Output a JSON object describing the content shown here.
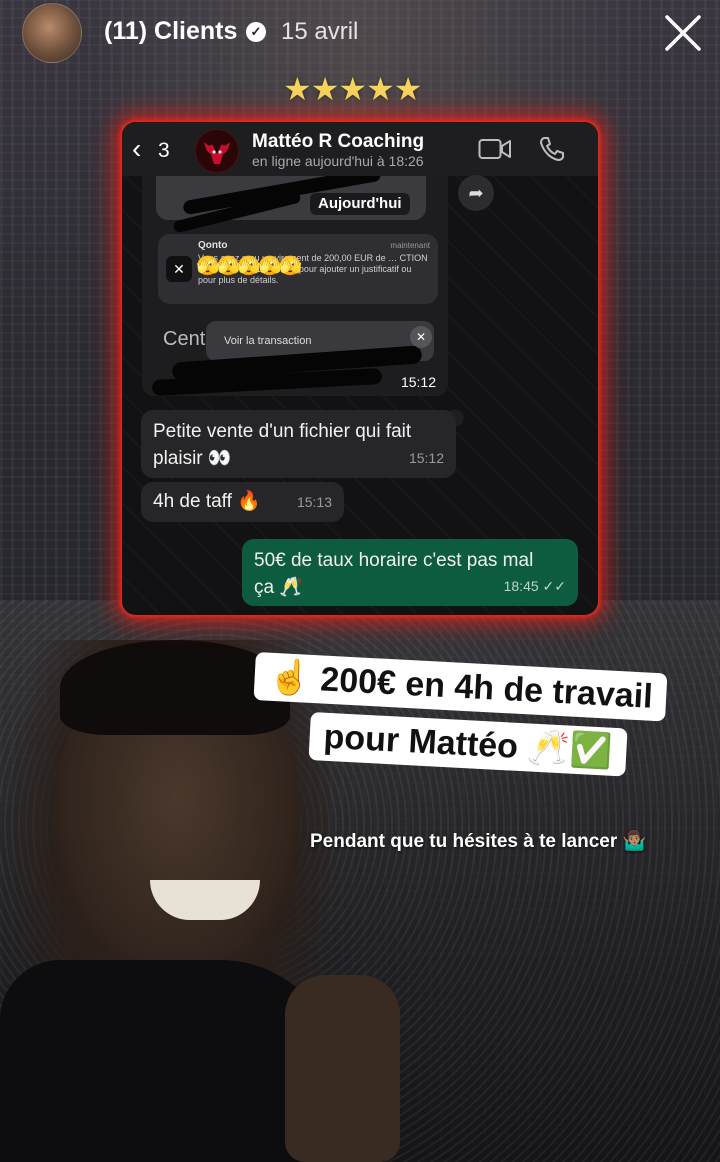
{
  "story": {
    "channel_name": "(11) Clients",
    "date": "15 avril",
    "stars": "★★★★★"
  },
  "chat": {
    "back_count": "3",
    "contact_name": "Mattéo R Coaching",
    "contact_status": "en ligne aujourd'hui à 18:26",
    "image_message": {
      "today_chip": "Aujourd'hui",
      "notif_app": "Qonto",
      "notif_time": "maintenant",
      "notif_text": "Vous avez reçu un virement de 200,00 EUR de … CTION HORTICOLE. Cliquez ici pour ajouter un justificatif ou pour plus de détails.",
      "emoji_row": "🫣🫣🫣🫣🫣",
      "cent_text": "Cent",
      "view_transaction": "Voir la transaction",
      "time": "15:12"
    },
    "messages": [
      {
        "text": "Petite vente d'un fichier qui fait plaisir 👀",
        "time": "15:12",
        "outgoing": false
      },
      {
        "text": "4h de taff 🔥",
        "time": "15:13",
        "outgoing": false
      },
      {
        "text": "50€ de taux horaire c'est pas mal ça 🥂",
        "time": "18:45 ✓✓",
        "outgoing": true
      }
    ]
  },
  "caption": {
    "line1": "☝️ 200€ en 4h de travail",
    "line2": "pour Mattéo 🥂✅",
    "tagline": "Pendant que tu hésites à te lancer 🤷🏽‍♂️"
  },
  "colors": {
    "glow": "#e81e14",
    "outgoing_bubble": "#0d5c3f",
    "incoming_bubble": "#262628",
    "stars": "#f6d45b"
  },
  "icons": [
    "close-icon",
    "verified-icon",
    "back-chevron-icon",
    "video-call-icon",
    "phone-icon",
    "forward-icon"
  ]
}
